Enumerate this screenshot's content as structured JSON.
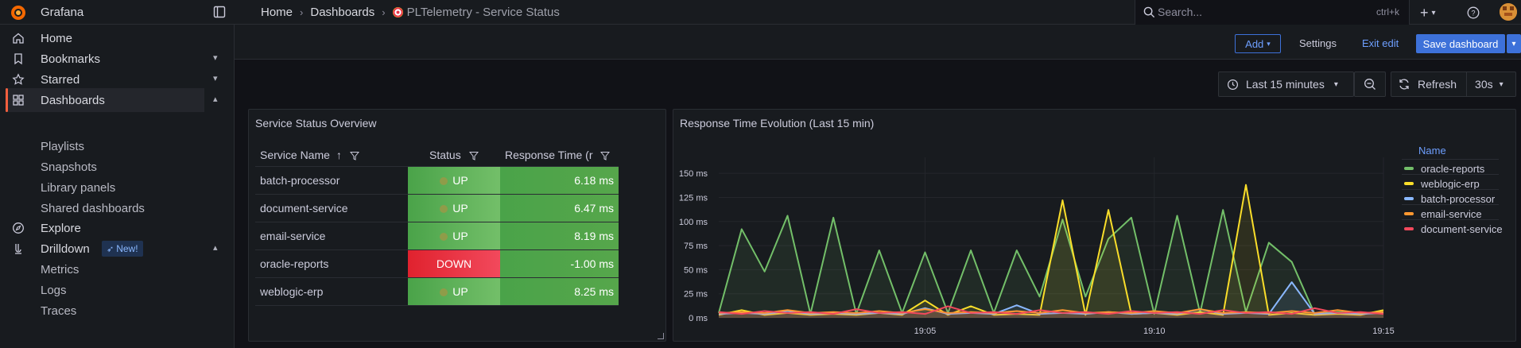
{
  "app": {
    "brand": "Grafana"
  },
  "breadcrumbs": {
    "home": "Home",
    "dashboards": "Dashboards",
    "current": "PLTelemetry - Service Status"
  },
  "search": {
    "placeholder": "Search...",
    "shortcut": "ctrl+k"
  },
  "toolbar": {
    "add": "Add",
    "settings": "Settings",
    "exit_edit": "Exit edit",
    "save": "Save dashboard"
  },
  "sidebar": {
    "home": "Home",
    "bookmarks": "Bookmarks",
    "starred": "Starred",
    "dashboards": "Dashboards",
    "playlists": "Playlists",
    "snapshots": "Snapshots",
    "library_panels": "Library panels",
    "shared_dashboards": "Shared dashboards",
    "explore": "Explore",
    "drilldown": "Drilldown",
    "new_badge": "New!",
    "metrics": "Metrics",
    "logs": "Logs",
    "traces": "Traces"
  },
  "time": {
    "range": "Last 15 minutes",
    "refresh": "Refresh",
    "interval": "30s"
  },
  "status_panel": {
    "title": "Service Status Overview",
    "columns": {
      "name": "Service Name",
      "status": "Status",
      "response": "Response Time (r"
    },
    "rows": [
      {
        "name": "batch-processor",
        "status": "UP",
        "response": "6.18 ms",
        "state": "up"
      },
      {
        "name": "document-service",
        "status": "UP",
        "response": "6.47 ms",
        "state": "up"
      },
      {
        "name": "email-service",
        "status": "UP",
        "response": "8.19 ms",
        "state": "up"
      },
      {
        "name": "oracle-reports",
        "status": "DOWN",
        "response": "-1.00 ms",
        "state": "down"
      },
      {
        "name": "weblogic-erp",
        "status": "UP",
        "response": "8.25 ms",
        "state": "up"
      }
    ],
    "colors": {
      "up": "#56a64b",
      "down": "#e0222e",
      "response": "#4aa349"
    }
  },
  "chart_panel": {
    "title": "Response Time Evolution (Last 15 min)"
  },
  "chart_data": {
    "type": "line",
    "title": "Response Time Evolution (Last 15 min)",
    "xlabel": "",
    "ylabel": "",
    "x_ticks": [
      "19:05",
      "19:10",
      "19:15"
    ],
    "y_ticks": [
      "0 ms",
      "25 ms",
      "50 ms",
      "75 ms",
      "100 ms",
      "125 ms",
      "150 ms"
    ],
    "ylim": [
      0,
      160
    ],
    "legend_title": "Name",
    "legend_position": "right",
    "x": [
      "19:00:30",
      "19:01:00",
      "19:01:30",
      "19:02:00",
      "19:02:30",
      "19:03:00",
      "19:03:30",
      "19:04:00",
      "19:04:30",
      "19:05:00",
      "19:05:30",
      "19:06:00",
      "19:06:30",
      "19:07:00",
      "19:07:30",
      "19:08:00",
      "19:08:30",
      "19:09:00",
      "19:09:30",
      "19:10:00",
      "19:10:30",
      "19:11:00",
      "19:11:30",
      "19:12:00",
      "19:12:30",
      "19:13:00",
      "19:13:30",
      "19:14:00",
      "19:14:30",
      "19:15:00"
    ],
    "series": [
      {
        "name": "oracle-reports",
        "color": "#73bf69",
        "values": [
          5,
          92,
          48,
          106,
          4,
          104,
          4,
          70,
          5,
          68,
          5,
          70,
          5,
          70,
          22,
          102,
          22,
          82,
          104,
          4,
          106,
          5,
          112,
          6,
          78,
          58,
          4,
          6,
          5,
          6
        ]
      },
      {
        "name": "weblogic-erp",
        "color": "#fade2a",
        "values": [
          3,
          8,
          3,
          5,
          3,
          4,
          3,
          5,
          3,
          18,
          3,
          12,
          3,
          4,
          3,
          122,
          3,
          112,
          4,
          5,
          3,
          6,
          3,
          138,
          3,
          5,
          3,
          4,
          3,
          8
        ]
      },
      {
        "name": "batch-processor",
        "color": "#8ab8ff",
        "values": [
          4,
          5,
          4,
          7,
          4,
          5,
          4,
          5,
          4,
          10,
          4,
          5,
          4,
          13,
          4,
          5,
          4,
          6,
          4,
          5,
          4,
          9,
          4,
          5,
          4,
          37,
          4,
          5,
          4,
          5
        ]
      },
      {
        "name": "email-service",
        "color": "#ff9830",
        "values": [
          5,
          6,
          5,
          8,
          5,
          6,
          5,
          7,
          5,
          9,
          5,
          6,
          5,
          7,
          5,
          8,
          5,
          6,
          5,
          7,
          5,
          9,
          5,
          6,
          5,
          7,
          5,
          8,
          5,
          6
        ]
      },
      {
        "name": "document-service",
        "color": "#f2495c",
        "values": [
          6,
          4,
          7,
          5,
          6,
          4,
          9,
          5,
          6,
          4,
          12,
          5,
          6,
          4,
          8,
          5,
          6,
          4,
          7,
          5,
          6,
          4,
          8,
          5,
          6,
          4,
          10,
          5,
          6,
          4
        ]
      }
    ]
  }
}
